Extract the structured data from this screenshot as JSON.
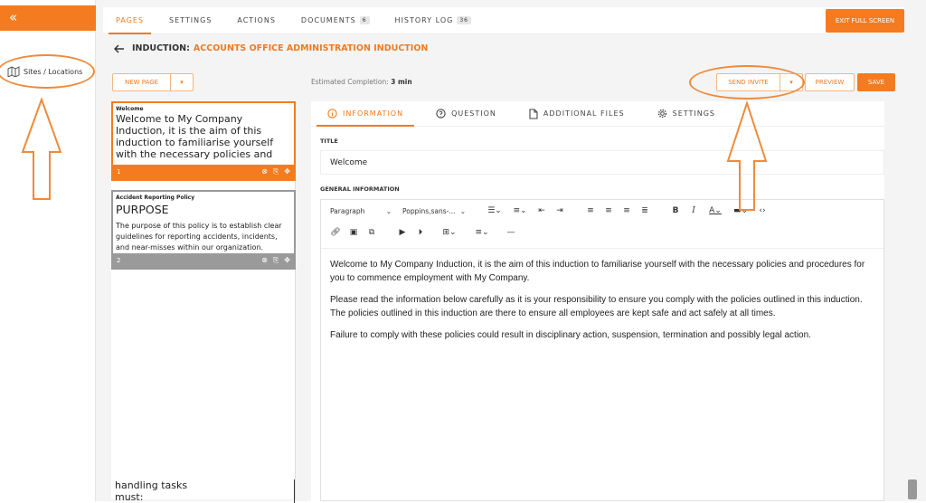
{
  "sidebar": {
    "toggle_icon": "«",
    "sites_label": "Sites / Locations"
  },
  "topnav": {
    "tabs": [
      {
        "label": "PAGES"
      },
      {
        "label": "SETTINGS"
      },
      {
        "label": "ACTIONS"
      },
      {
        "label": "DOCUMENTS",
        "count": "6"
      },
      {
        "label": "HISTORY LOG",
        "count": "36"
      }
    ],
    "exit_label": "EXIT FULL SCREEN"
  },
  "breadcrumb": {
    "label": "INDUCTION:",
    "value": "ACCOUNTS OFFICE ADMINISTRATION INDUCTION"
  },
  "actions": {
    "new_page": "NEW PAGE",
    "estimate_label": "Estimated Completion:",
    "estimate_value": "3 min",
    "send_invite": "SEND INVITE",
    "preview": "PREVIEW",
    "save": "SAVE"
  },
  "pages": [
    {
      "small_title": "Welcome",
      "big_text": "Welcome to My Company Induction, it is the aim of this induction to familiarise yourself with the necessary policies and procedures for you to",
      "number": "1"
    },
    {
      "small_title": "Accident Reporting Policy",
      "heading": "PURPOSE",
      "body": "The purpose of this policy is to establish clear guidelines for reporting accidents, incidents, and near-misses within our organization.",
      "number": "2"
    }
  ],
  "page_list_footer_text": "handling tasks must:",
  "editor": {
    "tabs": [
      {
        "label": "INFORMATION",
        "icon": "info-icon"
      },
      {
        "label": "QUESTION",
        "icon": "question-icon"
      },
      {
        "label": "ADDITIONAL FILES",
        "icon": "file-icon"
      },
      {
        "label": "SETTINGS",
        "icon": "gear-icon"
      }
    ],
    "title_label": "TITLE",
    "title_value": "Welcome",
    "general_label": "GENERAL INFORMATION",
    "format_select": "Paragraph",
    "font_select": "Poppins,sans-...",
    "paragraphs": [
      "Welcome to My Company Induction, it is the aim of this induction to familiarise yourself with the necessary policies and procedures for you to commence employment with My Company.",
      "Please read the information below carefully as it is your responsibility to ensure you comply with the policies outlined in this induction. The policies outlined in this induction are there to ensure all employees are kept safe and act safely at all times.",
      "Failure to comply with these policies could result in disciplinary action, suspension, termination and possibly legal action."
    ]
  },
  "colors": {
    "accent": "#f47b20",
    "annotation": "#f08a3b"
  }
}
